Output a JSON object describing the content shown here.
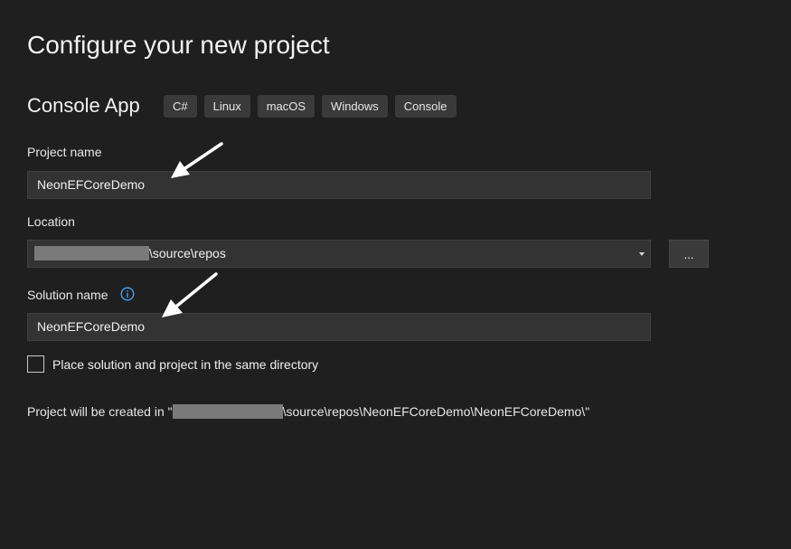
{
  "header": {
    "title": "Configure your new project"
  },
  "template": {
    "name": "Console App",
    "tags": [
      "C#",
      "Linux",
      "macOS",
      "Windows",
      "Console"
    ]
  },
  "project_name": {
    "label": "Project name",
    "value": "NeonEFCoreDemo"
  },
  "location": {
    "label": "Location",
    "value_suffix": "\\source\\repos",
    "browse_label": "..."
  },
  "solution_name": {
    "label": "Solution name",
    "value": "NeonEFCoreDemo"
  },
  "same_directory": {
    "label": "Place solution and project in the same directory",
    "checked": false
  },
  "created_path": {
    "prefix": "Project will be created in \"",
    "suffix": "\\source\\repos\\NeonEFCoreDemo\\NeonEFCoreDemo\\\""
  },
  "icons": {
    "info": "info-icon",
    "dropdown": "chevron-down-icon",
    "annotation": "annotation-arrow-icon"
  },
  "colors": {
    "background": "#1f1f1f",
    "input_background": "#333333",
    "tag_background": "#3a3a3a",
    "info_accent": "#4aa8ff",
    "redaction": "#7a7a7a"
  }
}
